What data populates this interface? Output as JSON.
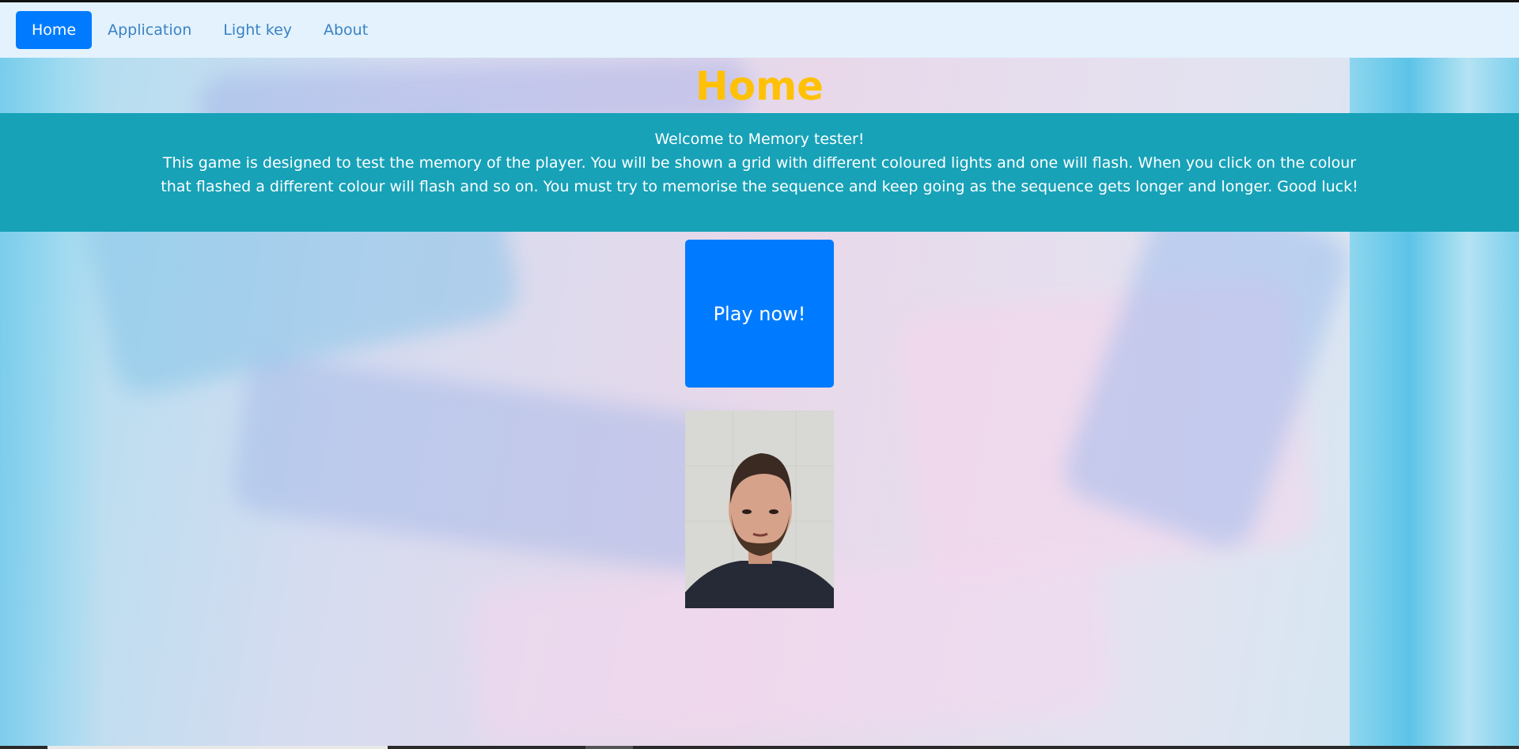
{
  "nav": {
    "items": [
      {
        "label": "Home",
        "active": true
      },
      {
        "label": "Application",
        "active": false
      },
      {
        "label": "Light key",
        "active": false
      },
      {
        "label": "About",
        "active": false
      }
    ]
  },
  "page": {
    "title": "Home"
  },
  "welcome": {
    "heading": "Welcome to Memory tester!",
    "description": "This game is designed to test the memory of the player. You will be shown a grid with different coloured lights and one will flash. When you click on the colour that flashed a different colour will flash and so on. You must try to memorise the sequence and keep going as the sequence gets longer and longer. Good luck!"
  },
  "play": {
    "label": "Play now!"
  },
  "colors": {
    "nav_bg": "#e3f2fd",
    "accent": "#007bff",
    "title": "#ffc107",
    "jumbotron": "#17a2b8"
  }
}
